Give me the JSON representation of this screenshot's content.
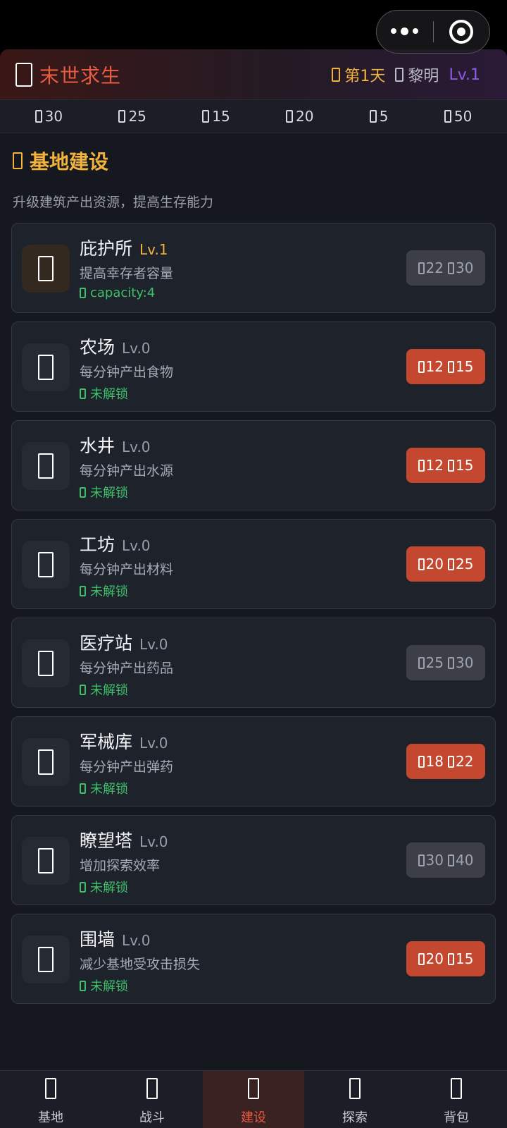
{
  "header": {
    "title": "末世求生",
    "day_label": "第1天",
    "time_of_day": "黎明",
    "level": "Lv.1"
  },
  "resources": [
    {
      "icon": "food-icon",
      "value": "30"
    },
    {
      "icon": "water-icon",
      "value": "25"
    },
    {
      "icon": "material-icon",
      "value": "15"
    },
    {
      "icon": "medicine-icon",
      "value": "20"
    },
    {
      "icon": "ammo-icon",
      "value": "5"
    },
    {
      "icon": "coin-icon",
      "value": "50"
    }
  ],
  "section": {
    "title": "基地建设",
    "description": "升级建筑产出资源，提高生存能力"
  },
  "buildings": [
    {
      "name": "庇护所",
      "level": "Lv.1",
      "desc": "提高幸存者容量",
      "status": "capacity:4",
      "cost1": "22",
      "cost2": "30",
      "affordable": false,
      "active": true
    },
    {
      "name": "农场",
      "level": "Lv.0",
      "desc": "每分钟产出食物",
      "status": "未解锁",
      "cost1": "12",
      "cost2": "15",
      "affordable": true,
      "active": false
    },
    {
      "name": "水井",
      "level": "Lv.0",
      "desc": "每分钟产出水源",
      "status": "未解锁",
      "cost1": "12",
      "cost2": "15",
      "affordable": true,
      "active": false
    },
    {
      "name": "工坊",
      "level": "Lv.0",
      "desc": "每分钟产出材料",
      "status": "未解锁",
      "cost1": "20",
      "cost2": "25",
      "affordable": true,
      "active": false
    },
    {
      "name": "医疗站",
      "level": "Lv.0",
      "desc": "每分钟产出药品",
      "status": "未解锁",
      "cost1": "25",
      "cost2": "30",
      "affordable": false,
      "active": false
    },
    {
      "name": "军械库",
      "level": "Lv.0",
      "desc": "每分钟产出弹药",
      "status": "未解锁",
      "cost1": "18",
      "cost2": "22",
      "affordable": true,
      "active": false
    },
    {
      "name": "瞭望塔",
      "level": "Lv.0",
      "desc": "增加探索效率",
      "status": "未解锁",
      "cost1": "30",
      "cost2": "40",
      "affordable": false,
      "active": false
    },
    {
      "name": "围墙",
      "level": "Lv.0",
      "desc": "减少基地受攻击损失",
      "status": "未解锁",
      "cost1": "20",
      "cost2": "15",
      "affordable": true,
      "active": false
    }
  ],
  "nav": [
    {
      "label": "基地",
      "icon": "home-icon",
      "active": false
    },
    {
      "label": "战斗",
      "icon": "sword-icon",
      "active": false
    },
    {
      "label": "建设",
      "icon": "hammer-icon",
      "active": true
    },
    {
      "label": "探索",
      "icon": "compass-icon",
      "active": false
    },
    {
      "label": "背包",
      "icon": "backpack-icon",
      "active": false
    }
  ],
  "colors": {
    "accent": "#e85a42",
    "gold": "#f2b33d",
    "button_active": "#c4482f",
    "status_green": "#3fbf6a"
  }
}
